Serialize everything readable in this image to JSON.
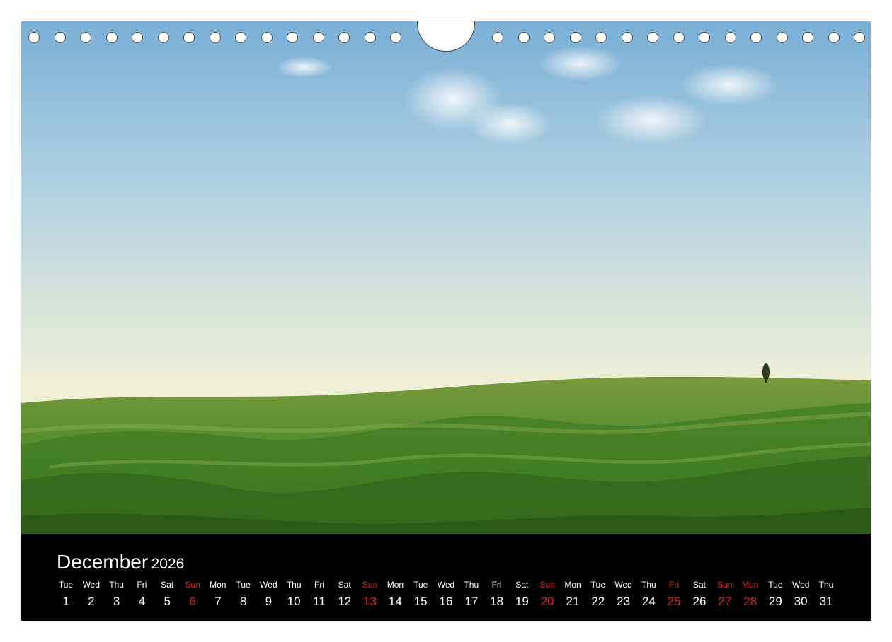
{
  "calendar": {
    "month": "December",
    "year": "2026",
    "days": [
      {
        "dow": "Tue",
        "num": "1",
        "red": false
      },
      {
        "dow": "Wed",
        "num": "2",
        "red": false
      },
      {
        "dow": "Thu",
        "num": "3",
        "red": false
      },
      {
        "dow": "Fri",
        "num": "4",
        "red": false
      },
      {
        "dow": "Sat",
        "num": "5",
        "red": false
      },
      {
        "dow": "Sun",
        "num": "6",
        "red": true
      },
      {
        "dow": "Mon",
        "num": "7",
        "red": false
      },
      {
        "dow": "Tue",
        "num": "8",
        "red": false
      },
      {
        "dow": "Wed",
        "num": "9",
        "red": false
      },
      {
        "dow": "Thu",
        "num": "10",
        "red": false
      },
      {
        "dow": "Fri",
        "num": "11",
        "red": false
      },
      {
        "dow": "Sat",
        "num": "12",
        "red": false
      },
      {
        "dow": "Sun",
        "num": "13",
        "red": true
      },
      {
        "dow": "Mon",
        "num": "14",
        "red": false
      },
      {
        "dow": "Tue",
        "num": "15",
        "red": false
      },
      {
        "dow": "Wed",
        "num": "16",
        "red": false
      },
      {
        "dow": "Thu",
        "num": "17",
        "red": false
      },
      {
        "dow": "Fri",
        "num": "18",
        "red": false
      },
      {
        "dow": "Sat",
        "num": "19",
        "red": false
      },
      {
        "dow": "Sun",
        "num": "20",
        "red": true
      },
      {
        "dow": "Mon",
        "num": "21",
        "red": false
      },
      {
        "dow": "Tue",
        "num": "22",
        "red": false
      },
      {
        "dow": "Wed",
        "num": "23",
        "red": false
      },
      {
        "dow": "Thu",
        "num": "24",
        "red": false
      },
      {
        "dow": "Fri",
        "num": "25",
        "red": true
      },
      {
        "dow": "Sat",
        "num": "26",
        "red": false
      },
      {
        "dow": "Sun",
        "num": "27",
        "red": true
      },
      {
        "dow": "Mon",
        "num": "28",
        "red": true
      },
      {
        "dow": "Tue",
        "num": "29",
        "red": false
      },
      {
        "dow": "Wed",
        "num": "30",
        "red": false
      },
      {
        "dow": "Thu",
        "num": "31",
        "red": false
      }
    ]
  },
  "colors": {
    "holiday_red": "#e0202a",
    "sky_top": "#7fb3d8",
    "sky_bottom": "#f4f0cf",
    "grass": "#4d8a2a"
  }
}
